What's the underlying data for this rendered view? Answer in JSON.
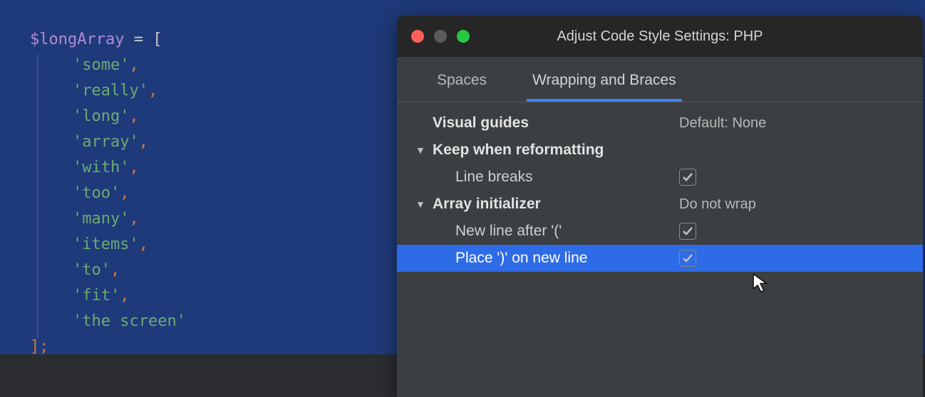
{
  "editor": {
    "var": "$longArray",
    "assign": " = [",
    "items": [
      "'some'",
      "'really'",
      "'long'",
      "'array'",
      "'with'",
      "'too'",
      "'many'",
      "'items'",
      "'to'",
      "'fit'",
      "'the screen'"
    ],
    "close": "];"
  },
  "dialog": {
    "title": "Adjust Code Style Settings: PHP",
    "tabs": {
      "spaces": "Spaces",
      "wrapping": "Wrapping and Braces"
    },
    "rows": {
      "visual_guides": "Visual guides",
      "visual_guides_value": "Default: None",
      "keep_when_reformatting": "Keep when reformatting",
      "line_breaks": "Line breaks",
      "array_initializer": "Array initializer",
      "array_initializer_value": "Do not wrap",
      "new_line_after": "New line after '('",
      "place_on_new_line": "Place ')' on new line"
    }
  }
}
